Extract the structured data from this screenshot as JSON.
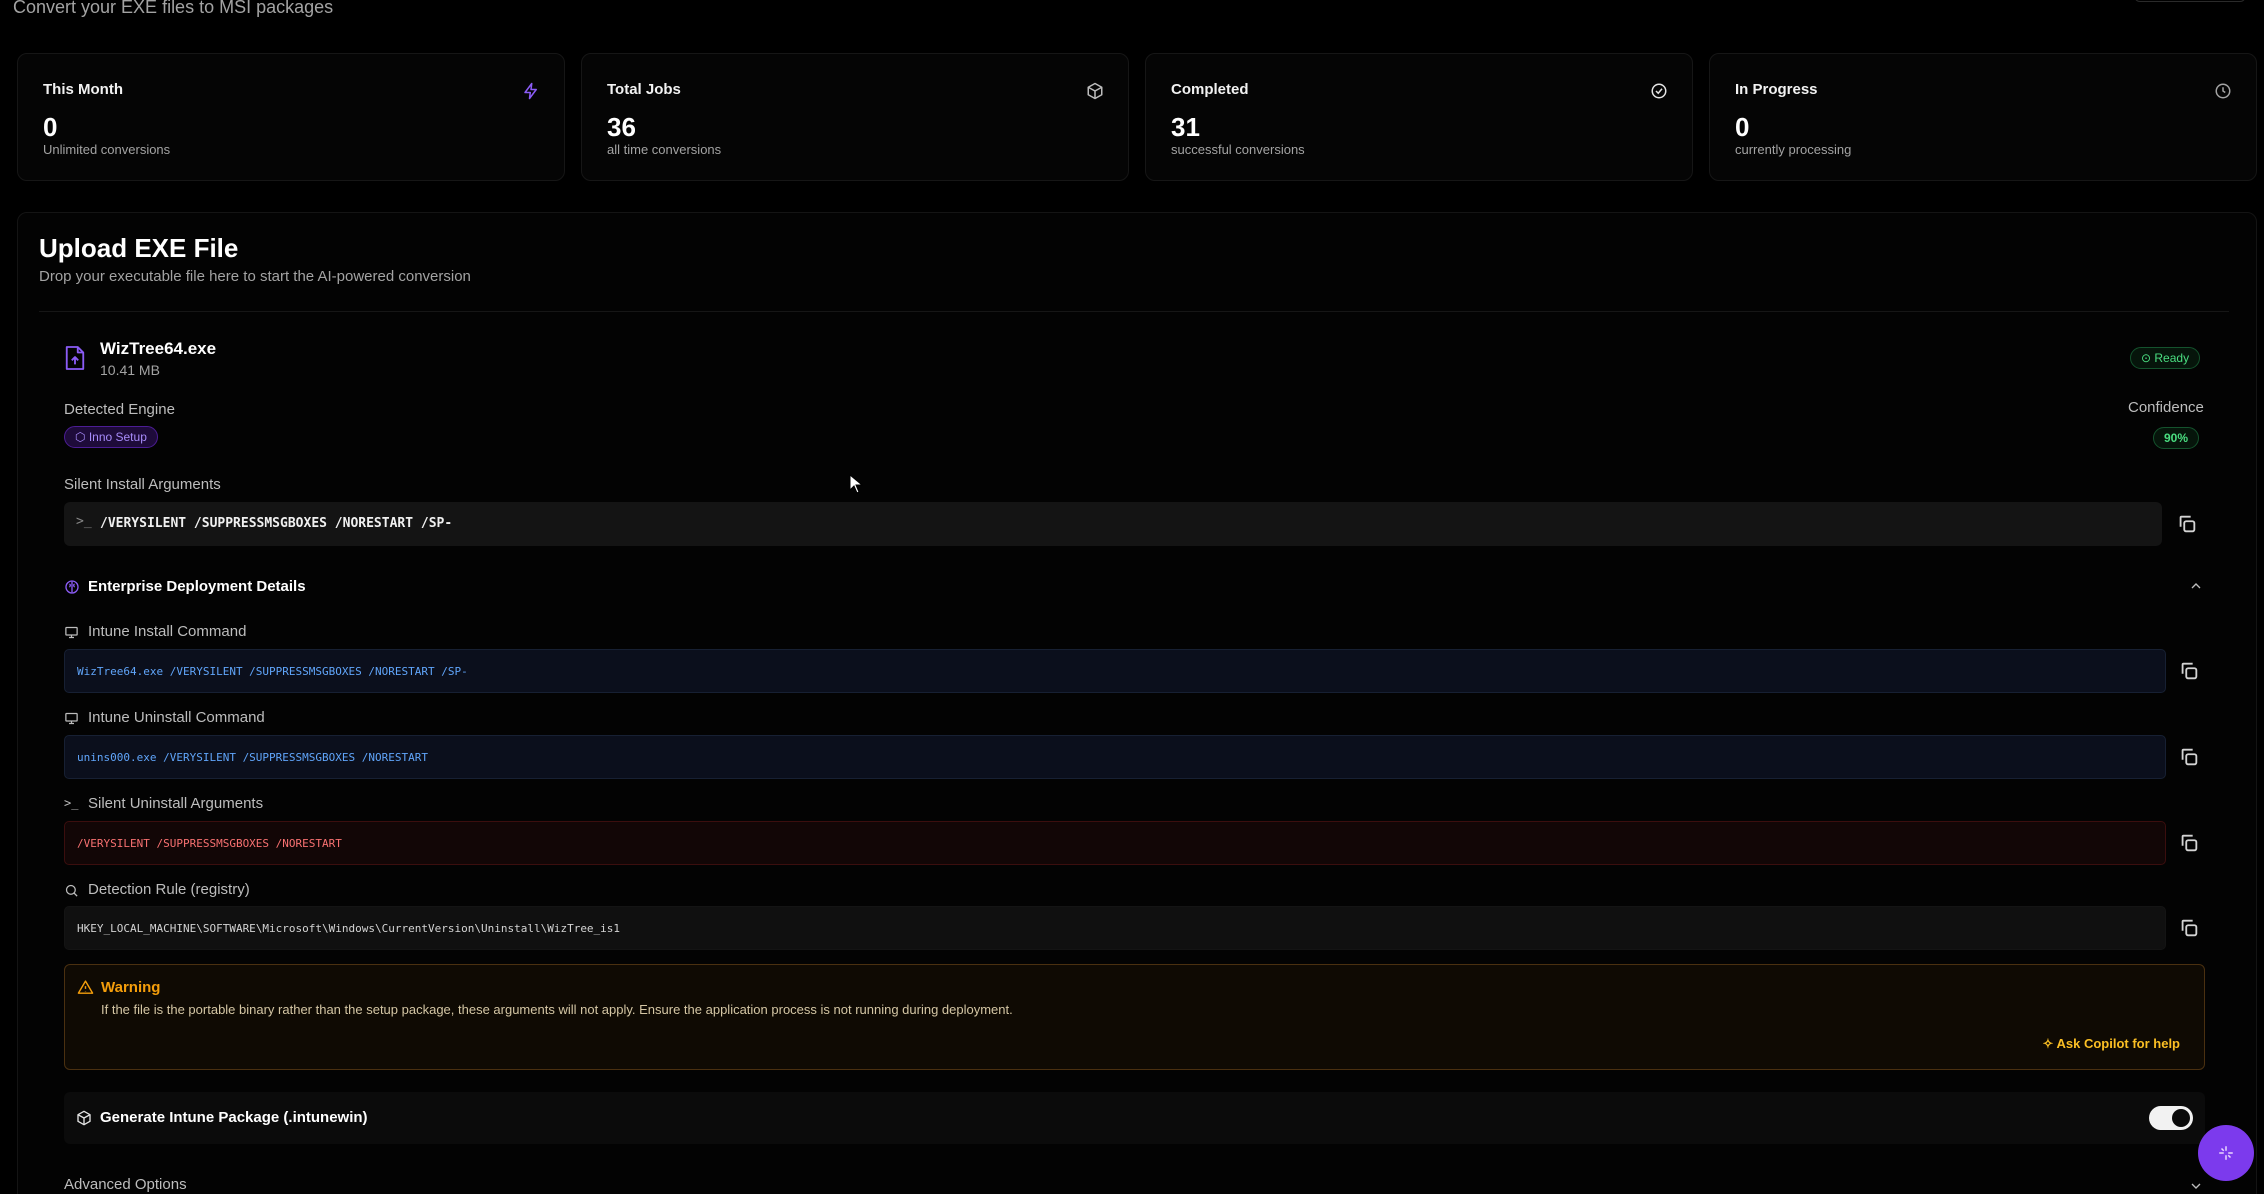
{
  "header": {
    "subtitle": "Convert your EXE files to MSI packages"
  },
  "stats": [
    {
      "label": "This Month",
      "value": "0",
      "desc": "Unlimited conversions",
      "icon": "zap-icon"
    },
    {
      "label": "Total Jobs",
      "value": "36",
      "desc": "all time conversions",
      "icon": "package-icon"
    },
    {
      "label": "Completed",
      "value": "31",
      "desc": "successful conversions",
      "icon": "check-circle-icon"
    },
    {
      "label": "In Progress",
      "value": "0",
      "desc": "currently processing",
      "icon": "clock-icon"
    }
  ],
  "upload": {
    "title": "Upload EXE File",
    "subtitle": "Drop your executable file here to start the AI-powered conversion"
  },
  "file": {
    "name": "WizTree64.exe",
    "size": "10.41 MB",
    "status": "Ready",
    "engine_label": "Detected Engine",
    "engine": "Inno Setup",
    "confidence_label": "Confidence",
    "confidence": "90%",
    "silent_label": "Silent Install Arguments",
    "silent_args": "/VERYSILENT /SUPPRESSMSGBOXES /NORESTART /SP-"
  },
  "enterprise": {
    "title": "Enterprise Deployment Details",
    "fields": [
      {
        "label": "Intune Install Command",
        "value": "WizTree64.exe /VERYSILENT /SUPPRESSMSGBOXES /NORESTART /SP-"
      },
      {
        "label": "Intune Uninstall Command",
        "value": "unins000.exe /VERYSILENT /SUPPRESSMSGBOXES /NORESTART"
      },
      {
        "label": "Silent Uninstall Arguments",
        "value": "/VERYSILENT /SUPPRESSMSGBOXES /NORESTART"
      },
      {
        "label": "Detection Rule (registry)",
        "value": "HKEY_LOCAL_MACHINE\\SOFTWARE\\Microsoft\\Windows\\CurrentVersion\\Uninstall\\WizTree_is1"
      }
    ]
  },
  "warning": {
    "title": "Warning",
    "message": "If the file is the portable binary rather than the setup package, these arguments will not apply. Ensure the application process is not running during deployment.",
    "ask": "Ask Copilot for help"
  },
  "package": {
    "label": "Generate Intune Package (.intunewin)",
    "enabled": true
  },
  "advanced": {
    "label": "Advanced Options"
  },
  "colors": {
    "accent": "#7c3aed",
    "success": "#4ade80",
    "warning": "#f59e0b",
    "info": "#60a5fa",
    "danger": "#f87171"
  }
}
